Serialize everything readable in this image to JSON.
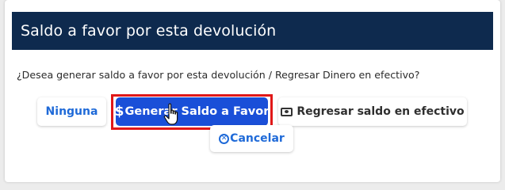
{
  "dialog": {
    "title": "Saldo a favor por esta devolución",
    "question": "¿Desea generar saldo a favor por esta devolución / Regresar Dinero en efectivo?",
    "buttons": {
      "ninguna": "Ninguna",
      "generar_symbol": "$",
      "generar": "Generar Saldo a Favor",
      "efectivo": "Regresar saldo en efectivo",
      "cancelar": "Cancelar"
    }
  },
  "icons": {
    "generar": "dollar-icon",
    "efectivo": "cash-icon",
    "cancelar": "x-circle-icon",
    "cursor": "hand-pointer-icon"
  },
  "colors": {
    "header_bg": "#0e2a4e",
    "primary": "#1a4fd8",
    "link_blue": "#1f6ad8",
    "highlight": "#e01818"
  }
}
